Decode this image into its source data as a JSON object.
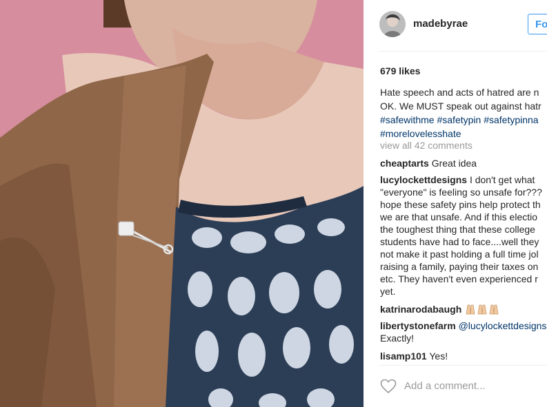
{
  "post": {
    "username": "madebyrae",
    "follow_label": "Fo",
    "likes": "679 likes",
    "caption_lines": [
      "Hate speech and acts of hatred are n",
      "OK. We MUST speak out against hatr"
    ],
    "caption_hashtags": [
      "#safewithme #safetypin #safetypinna",
      "#morelovelesshate"
    ],
    "view_all": "view all 42 comments",
    "comments": [
      {
        "user": "cheaptarts",
        "lines": [
          "Great idea"
        ]
      },
      {
        "user": "lucylockettdesigns",
        "lines": [
          "I don't get what",
          "\"everyone\" is feeling so unsafe for???",
          "hope these safety pins help protect th",
          "we are that unsafe. And if this electio",
          "the toughest thing that these college",
          "students have had to face....well they",
          "not make it past holding a full time jol",
          "raising a family, paying their taxes on",
          "etc. They haven't even experienced r",
          "yet."
        ]
      },
      {
        "user": "katrinarodabaugh",
        "lines": [
          ""
        ]
      },
      {
        "user": "libertystonefarm",
        "lines": [
          "@lucylockettdesigns",
          "Exactly!"
        ]
      },
      {
        "user": "lisamp101",
        "lines": [
          "Yes!"
        ]
      }
    ],
    "add_comment_placeholder": "Add a comment..."
  },
  "icons": {
    "heart": "heart-outline-icon",
    "emoji": "folded-hands-emoji-icon"
  },
  "colors": {
    "link": "#003569",
    "follow": "#3897f0",
    "muted": "#999999"
  }
}
